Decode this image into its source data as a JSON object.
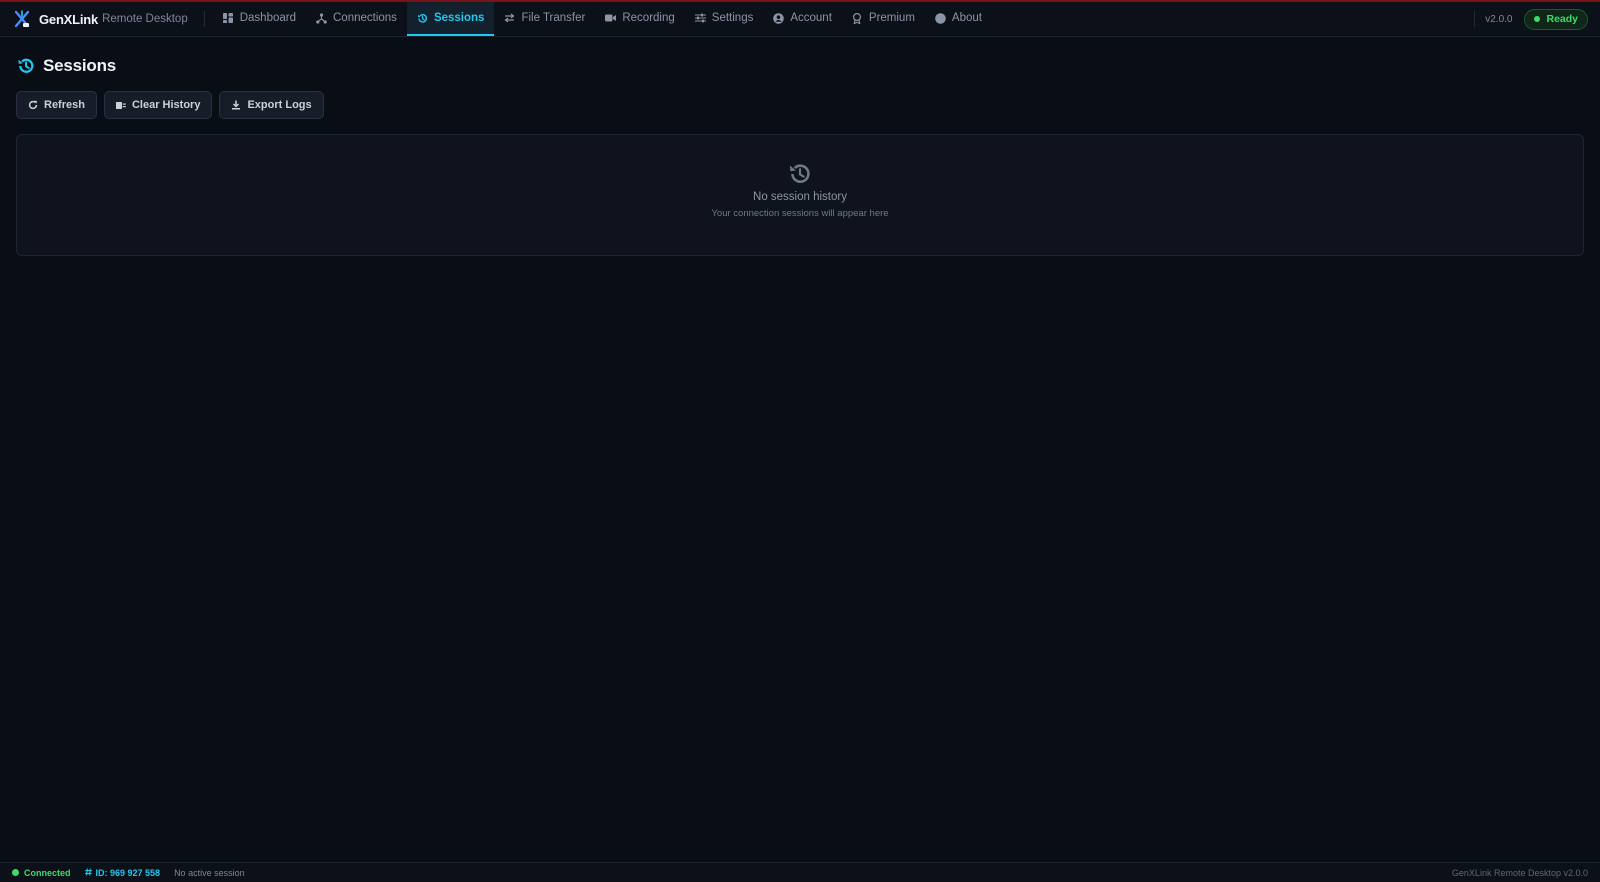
{
  "brand": {
    "name": "GenXLink",
    "subtitle": "Remote Desktop"
  },
  "nav": {
    "items": [
      {
        "label": "Dashboard",
        "icon": "dashboard-icon"
      },
      {
        "label": "Connections",
        "icon": "connections-icon"
      },
      {
        "label": "Sessions",
        "icon": "history-icon",
        "active": true
      },
      {
        "label": "File Transfer",
        "icon": "transfer-icon"
      },
      {
        "label": "Recording",
        "icon": "video-camera-icon"
      },
      {
        "label": "Settings",
        "icon": "sliders-icon"
      },
      {
        "label": "Account",
        "icon": "user-circle-icon"
      },
      {
        "label": "Premium",
        "icon": "award-icon"
      },
      {
        "label": "About",
        "icon": "info-circle-icon"
      }
    ]
  },
  "header": {
    "version": "v2.0.0",
    "status": "Ready"
  },
  "page": {
    "title": "Sessions",
    "toolbar": {
      "refresh_label": "Refresh",
      "clear_label": "Clear History",
      "export_label": "Export Logs"
    },
    "empty": {
      "title": "No session history",
      "subtitle": "Your connection sessions will appear here"
    }
  },
  "statusbar": {
    "connection": "Connected",
    "id": "ID: 969 927 558",
    "session": "No active session",
    "app": "GenXLink Remote Desktop v2.0.0"
  },
  "colors": {
    "accent": "#22c8ee",
    "success": "#3ddc6a",
    "background": "#090d16"
  }
}
